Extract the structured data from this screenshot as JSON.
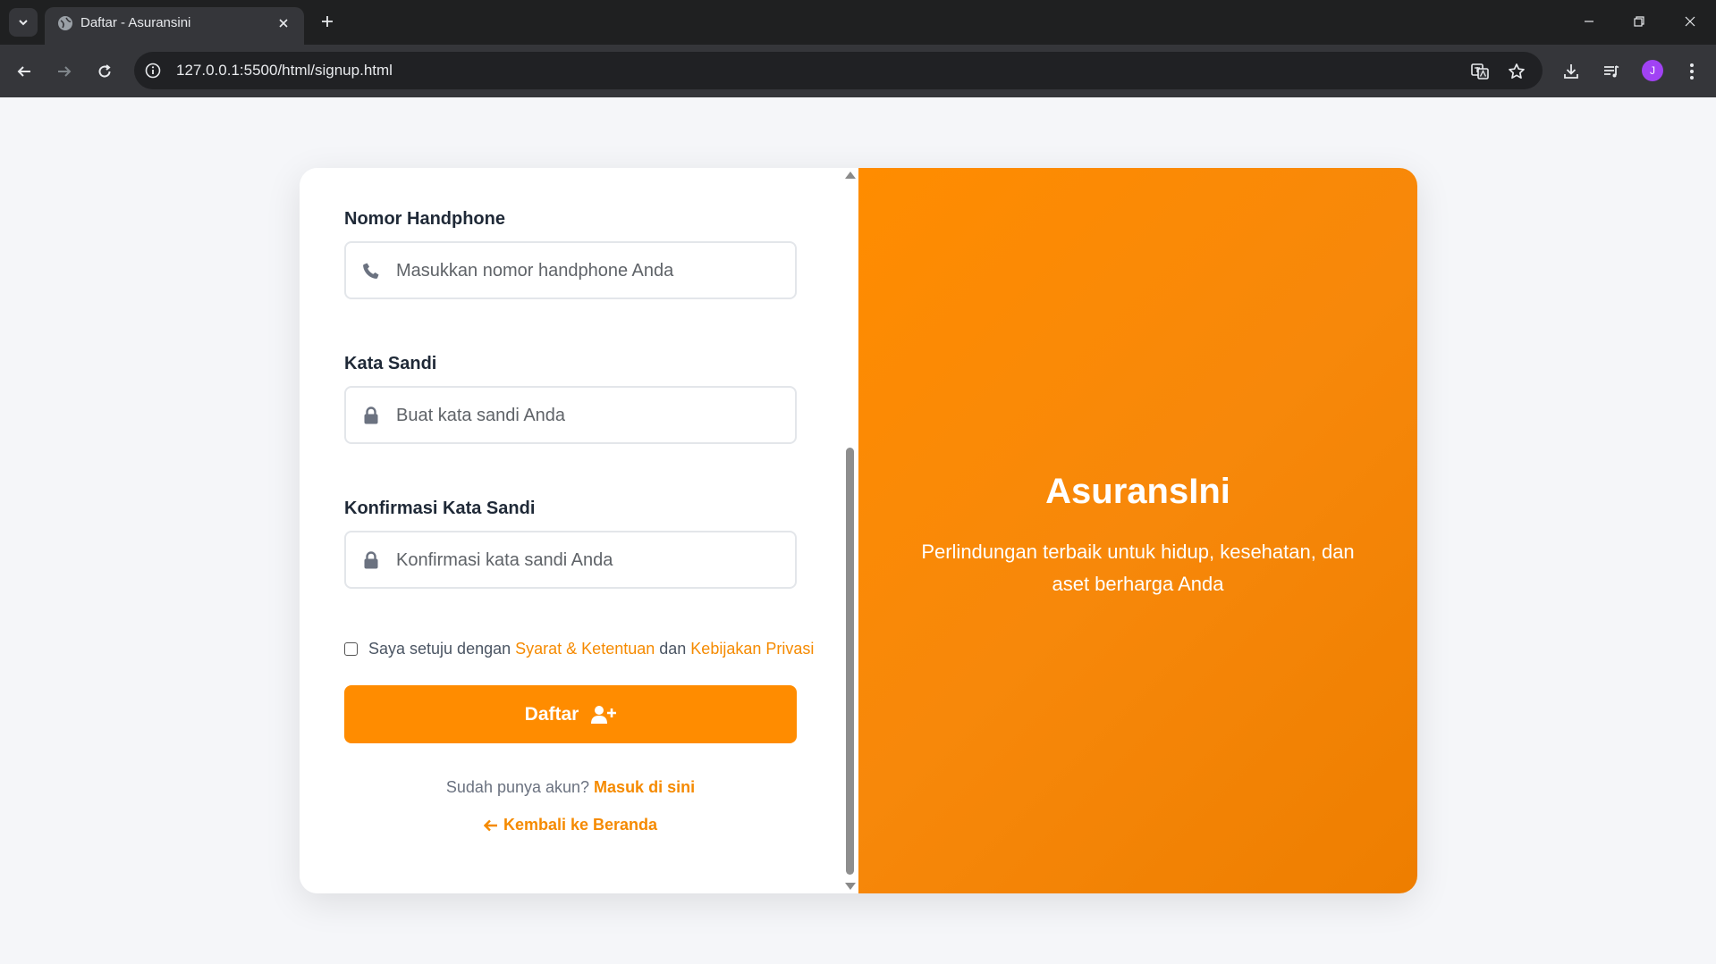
{
  "browser": {
    "tab_title": "Daftar - Asuransini",
    "url": "127.0.0.1:5500/html/signup.html",
    "profile_initial": "J"
  },
  "form": {
    "phone": {
      "label": "Nomor Handphone",
      "placeholder": "Masukkan nomor handphone Anda"
    },
    "password": {
      "label": "Kata Sandi",
      "placeholder": "Buat kata sandi Anda"
    },
    "confirm": {
      "label": "Konfirmasi Kata Sandi",
      "placeholder": "Konfirmasi kata sandi Anda"
    },
    "terms": {
      "prefix": "Saya setuju dengan ",
      "terms_link": "Syarat & Ketentuan",
      "middle": " dan ",
      "privacy_link": "Kebijakan Privasi"
    },
    "submit_label": "Daftar",
    "login_prompt": "Sudah punya akun? ",
    "login_link": "Masuk di sini",
    "back_link": "Kembali ke Beranda"
  },
  "brand": {
    "title": "AsuransIni",
    "subtitle": "Perlindungan terbaik untuk hidup, kesehatan, dan aset berharga Anda"
  },
  "colors": {
    "accent": "#ff8c00",
    "panel": "#f7880a",
    "text": "#1f2937"
  },
  "icons": [
    "phone-icon",
    "lock-icon",
    "user-plus-icon",
    "arrow-left-icon"
  ]
}
